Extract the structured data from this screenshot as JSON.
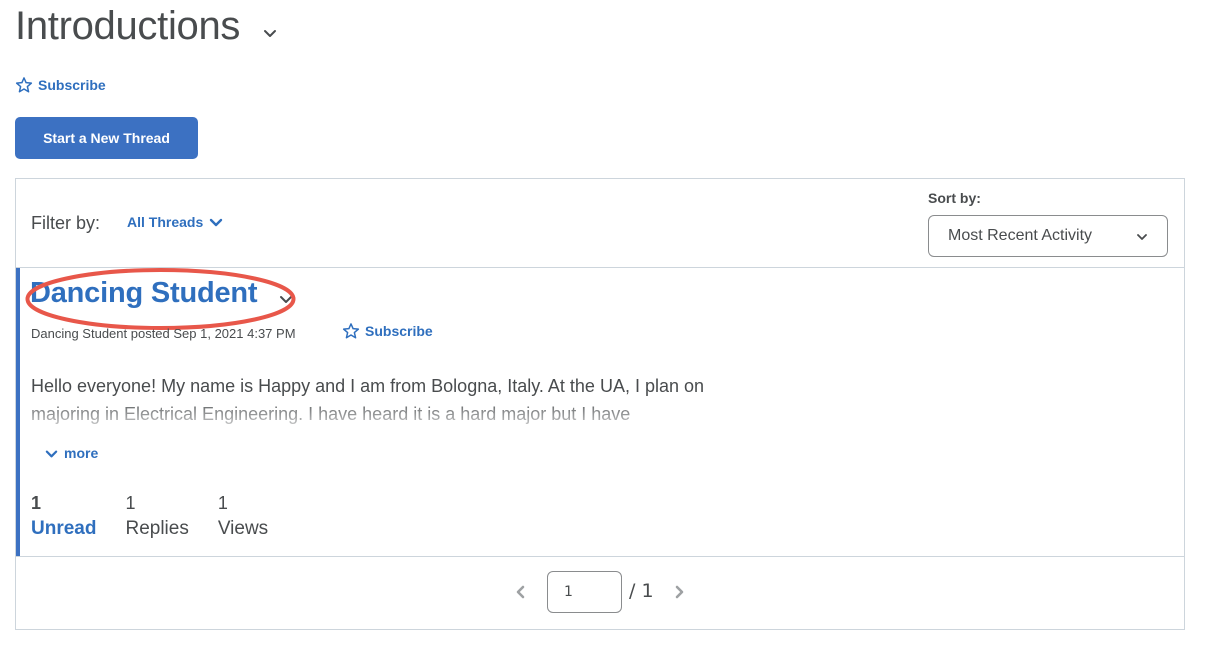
{
  "header": {
    "title": "Introductions",
    "title_menu_icon": "chevron-down-icon",
    "subscribe_label": "Subscribe",
    "subscribe_icon": "star-outline-icon",
    "new_thread_label": "Start a New Thread"
  },
  "filter": {
    "label": "Filter by:",
    "selected": "All Threads",
    "icon": "chevron-down-icon"
  },
  "sort": {
    "label": "Sort by:",
    "selected": "Most Recent Activity",
    "icon": "chevron-down-icon"
  },
  "threads": [
    {
      "title": "Dancing Student",
      "highlighted": true,
      "meta": "Dancing Student posted Sep 1, 2021 4:37 PM",
      "subscribe_label": "Subscribe",
      "body": "Hello everyone! My name is Happy and I am from Bologna, Italy. At the UA, I plan on majoring in Electrical Engineering. I have heard it is a hard major but I have",
      "more_label": "more",
      "stats": [
        {
          "value": "1",
          "label": "Unread"
        },
        {
          "value": "1",
          "label": "Replies"
        },
        {
          "value": "1",
          "label": "Views"
        }
      ]
    }
  ],
  "pagination": {
    "current_page": "1",
    "total_label": "/ 1",
    "prev_icon": "chevron-left-icon",
    "next_icon": "chevron-right-icon"
  },
  "colors": {
    "accent": "#3c71c2",
    "link": "#2f6fbe",
    "text": "#494c4e",
    "border": "#cdd5dc",
    "annotation": "#e8574a"
  }
}
